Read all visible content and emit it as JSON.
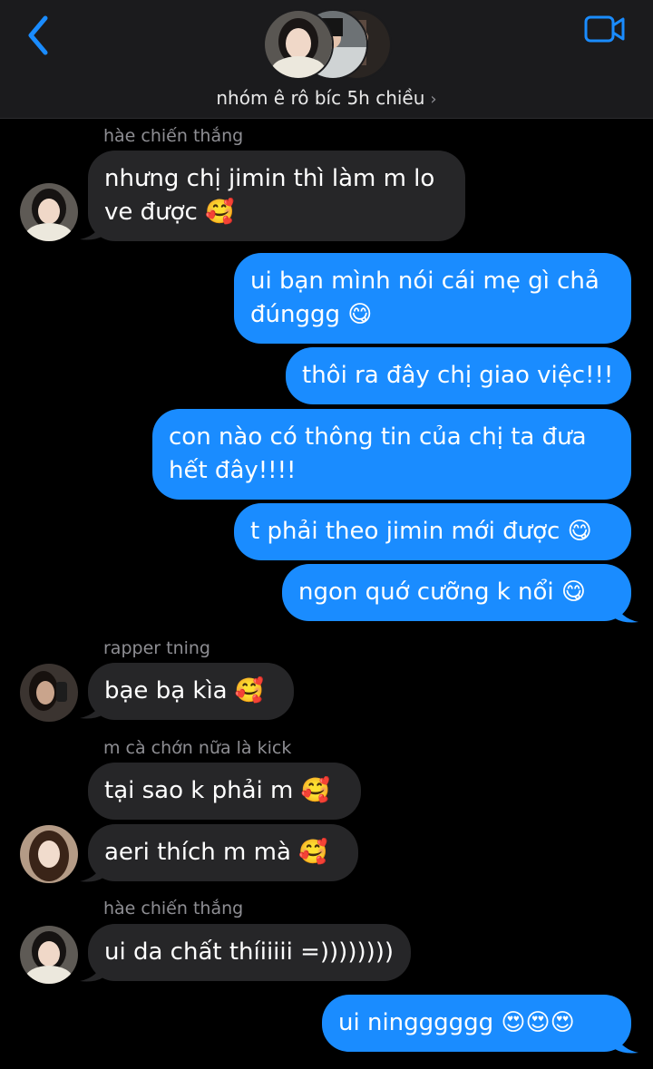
{
  "header": {
    "group_name": "nhóm ê rô bíc 5h chiều",
    "chevron": "›",
    "back_icon": "chevron-left-icon",
    "video_icon": "video-camera-icon"
  },
  "colors": {
    "accent": "#1a8cff",
    "incoming": "#262628",
    "header_bg": "#1b1b1d"
  },
  "messages": {
    "s1_sender": "hàe chiến thắng",
    "m1_line1": "nhưng chị jimin thì làm m lo",
    "m1_line2": "ve được 🥰",
    "m2_line1": "ui bạn mình nói cái mẹ gì chả",
    "m2_line2": "đúnggg 😋",
    "m3": "thôi ra đây chị giao việc!!!",
    "m4_line1": "con nào có thông tin của chị ta đưa",
    "m4_line2": "hết đây!!!!",
    "m5": "t phải theo jimin mới được 😋",
    "m6": "ngon quớ cưỡng k nổi 😋",
    "s2_sender": "rapper tning",
    "m7": "bạe bạ kìa 🥰",
    "s3_sender": "m cà chớn nữa là kick",
    "m8": "tại sao k phải m 🥰",
    "m9": "aeri thích m mà 🥰",
    "s4_sender": "hàe chiến thắng",
    "m10": "ui da chất thíiiiii =))))))))",
    "m11": "ui ningggggg 😍😍😍"
  }
}
